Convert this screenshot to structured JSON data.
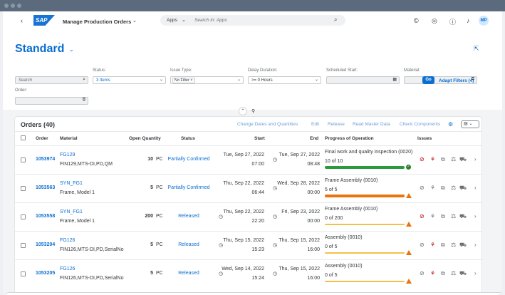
{
  "shell": {
    "title": "Manage Production Orders",
    "apps_label": "Apps",
    "search_placeholder": "Search in: Apps",
    "avatar": "MP",
    "logo": "SAP"
  },
  "page": {
    "variant_title": "Standard"
  },
  "filters": {
    "search_placeholder": "Search",
    "status_label": "Status:",
    "status_value": "3 Items",
    "issue_label": "Issue Type:",
    "issue_value": "No Filter",
    "delay_label": "Delay Duration:",
    "delay_value": ">= 0 Hours",
    "sched_label": "Scheduled Start:",
    "material_label": "Material:",
    "order_label": "Order:",
    "go": "Go",
    "adapt": "Adapt Filters (4)"
  },
  "table": {
    "title": "Orders (40)",
    "actions": [
      "Change Dates and Quantities",
      "Edit",
      "Release",
      "Read Master Data",
      "Check Components"
    ],
    "columns": [
      "Order",
      "Material",
      "Open Quantity",
      "Status",
      "Start",
      "End",
      "Progress of Operation",
      "Issues"
    ],
    "rows": [
      {
        "order": "1053974",
        "material": "FG129",
        "material_desc": "FIN129,MTS-DI,PD,QM",
        "qty": "10",
        "unit": "PC",
        "status": "Partially Confirmed",
        "start_date": "Tue, Sep 27, 2022",
        "start_time": "07:00",
        "end_date": "Tue, Sep 27, 2022",
        "end_time": "08:48",
        "op": "Final work and quality inspection (0020)",
        "progress_text": "10 of 10",
        "progress": 1.0,
        "color": "#2b9a3d",
        "state": "ok"
      },
      {
        "order": "1053563",
        "material": "SYN_FG1",
        "material_desc": "Frame, Model 1",
        "qty": "5",
        "unit": "PC",
        "status": "Partially Confirmed",
        "start_date": "Thu, Sep 22, 2022",
        "start_time": "06:44",
        "end_date": "Wed, Sep 28, 2022",
        "end_time": "00:00",
        "op": "Frame Assembly (0010)",
        "progress_text": "5 of 5",
        "progress": 1.0,
        "color": "#e9730c",
        "state": "warn"
      },
      {
        "order": "1053558",
        "material": "SYN_FG1",
        "material_desc": "Frame, Model 1",
        "qty": "200",
        "unit": "PC",
        "status": "Released",
        "start_date": "Thu, Sep 22, 2022",
        "start_time": "22:20",
        "end_date": "Fri, Sep 23, 2022",
        "end_time": "00:00",
        "op": "Frame Assembly (0010)",
        "progress_text": "0 of 200",
        "progress": 0.0,
        "color": "#f5c04a",
        "state": "warn"
      },
      {
        "order": "1053204",
        "material": "FG126",
        "material_desc": "FIN126,MTS-DI,PD,SerialNo",
        "qty": "5",
        "unit": "PC",
        "status": "Released",
        "start_date": "Thu, Sep 15, 2022",
        "start_time": "15:23",
        "end_date": "Thu, Sep 15, 2022",
        "end_time": "16:00",
        "op": "Assembly (0010)",
        "progress_text": "0 of 5",
        "progress": 0.0,
        "color": "#f5c04a",
        "state": "warn"
      },
      {
        "order": "1053205",
        "material": "FG126",
        "material_desc": "FIN126,MTS-DI,PD,SerialNo",
        "qty": "5",
        "unit": "PC",
        "status": "Released",
        "start_date": "Wed, Sep 14, 2022",
        "start_time": "15:24",
        "end_date": "Thu, Sep 15, 2022",
        "end_time": "16:00",
        "op": "Assembly (0010)",
        "progress_text": "0 of 5",
        "progress": 0.0,
        "color": "#f5c04a",
        "state": "warn"
      }
    ]
  }
}
